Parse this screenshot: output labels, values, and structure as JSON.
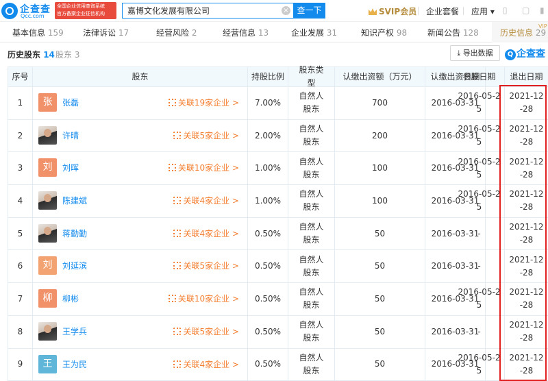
{
  "header": {
    "logo_cn": "企查查",
    "logo_en": "Qcc.com",
    "badge_line1": "全国企业信用查询系统",
    "badge_line2": "官方备案企业征信机构",
    "search_value": "嘉博文化发展有限公司",
    "search_button": "查一下",
    "svip": "SVIP会员",
    "enterprise_package": "企业套餐",
    "apps": "应用 ▾"
  },
  "tabs": [
    {
      "label": "基本信息",
      "count": "159"
    },
    {
      "label": "法律诉讼",
      "count": "17"
    },
    {
      "label": "经营风险",
      "count": "2"
    },
    {
      "label": "经营信息",
      "count": "13"
    },
    {
      "label": "企业发展",
      "count": "31"
    },
    {
      "label": "知识产权",
      "count": "98"
    },
    {
      "label": "新闻公告",
      "count": "128"
    },
    {
      "label": "历史信息",
      "count": "29",
      "vip": "VIP"
    }
  ],
  "subbar": {
    "active_label": "历史股东",
    "active_count": "14",
    "other_label": "股东",
    "other_count": "3",
    "export": "导出数据",
    "qcc": "企查查"
  },
  "table": {
    "headers": [
      "序号",
      "股东",
      "持股比例",
      "股东类型",
      "认缴出资额（万元）",
      "认缴出资日期",
      "参股日期",
      "退出日期"
    ],
    "rows": [
      {
        "no": "1",
        "avatar": "张",
        "avatar_color": "#f1916a",
        "photo": false,
        "name": "张磊",
        "related": "关联19家企业 >",
        "ratio": "7.00%",
        "type": "自然人股东",
        "amount": "700",
        "sub_date": "2016-03-31",
        "join_date": "2016-05-25",
        "exit_date": "2021-12-28"
      },
      {
        "no": "2",
        "avatar": "",
        "avatar_color": "#555555",
        "photo": true,
        "name": "许晴",
        "related": "关联5家企业 >",
        "ratio": "2.00%",
        "type": "自然人股东",
        "amount": "200",
        "sub_date": "2016-03-31",
        "join_date": "2016-05-25",
        "exit_date": "2021-12-28"
      },
      {
        "no": "3",
        "avatar": "刘",
        "avatar_color": "#f1916a",
        "photo": false,
        "name": "刘晖",
        "related": "关联10家企业 >",
        "ratio": "1.00%",
        "type": "自然人股东",
        "amount": "100",
        "sub_date": "2016-03-31",
        "join_date": "2016-05-25",
        "exit_date": "2021-12-28"
      },
      {
        "no": "4",
        "avatar": "",
        "avatar_color": "#555555",
        "photo": true,
        "name": "陈建斌",
        "related": "关联4家企业 >",
        "ratio": "1.00%",
        "type": "自然人股东",
        "amount": "100",
        "sub_date": "2016-03-31",
        "join_date": "2016-05-25",
        "exit_date": "2021-12-28"
      },
      {
        "no": "5",
        "avatar": "",
        "avatar_color": "#555555",
        "photo": true,
        "name": "蒋勤勤",
        "related": "关联4家企业 >",
        "ratio": "0.50%",
        "type": "自然人股东",
        "amount": "50",
        "sub_date": "2016-03-31",
        "join_date": "-",
        "exit_date": "2021-12-28"
      },
      {
        "no": "6",
        "avatar": "刘",
        "avatar_color": "#f3a271",
        "photo": false,
        "name": "刘延滨",
        "related": "关联5家企业 >",
        "ratio": "0.50%",
        "type": "自然人股东",
        "amount": "50",
        "sub_date": "2016-03-31",
        "join_date": "-",
        "exit_date": "2021-12-28"
      },
      {
        "no": "7",
        "avatar": "柳",
        "avatar_color": "#f1916a",
        "photo": false,
        "name": "柳彬",
        "related": "关联10家企业 >",
        "ratio": "0.50%",
        "type": "自然人股东",
        "amount": "50",
        "sub_date": "2016-03-31",
        "join_date": "2016-05-25",
        "exit_date": "2021-12-28"
      },
      {
        "no": "8",
        "avatar": "",
        "avatar_color": "#555555",
        "photo": true,
        "name": "王学兵",
        "related": "关联5家企业 >",
        "ratio": "0.50%",
        "type": "自然人股东",
        "amount": "50",
        "sub_date": "2016-03-31",
        "join_date": "-",
        "exit_date": "2021-12-28"
      },
      {
        "no": "9",
        "avatar": "王",
        "avatar_color": "#5fb6d9",
        "photo": false,
        "name": "王为民",
        "related": "关联4家企业 >",
        "ratio": "0.50%",
        "type": "自然人股东",
        "amount": "50",
        "sub_date": "2016-03-31",
        "join_date": "2016-05-25",
        "exit_date": "2021-12-28"
      }
    ]
  },
  "colors": {
    "brand": "#128bed",
    "related": "#f47e2f",
    "highlight": "#e21f1f"
  }
}
